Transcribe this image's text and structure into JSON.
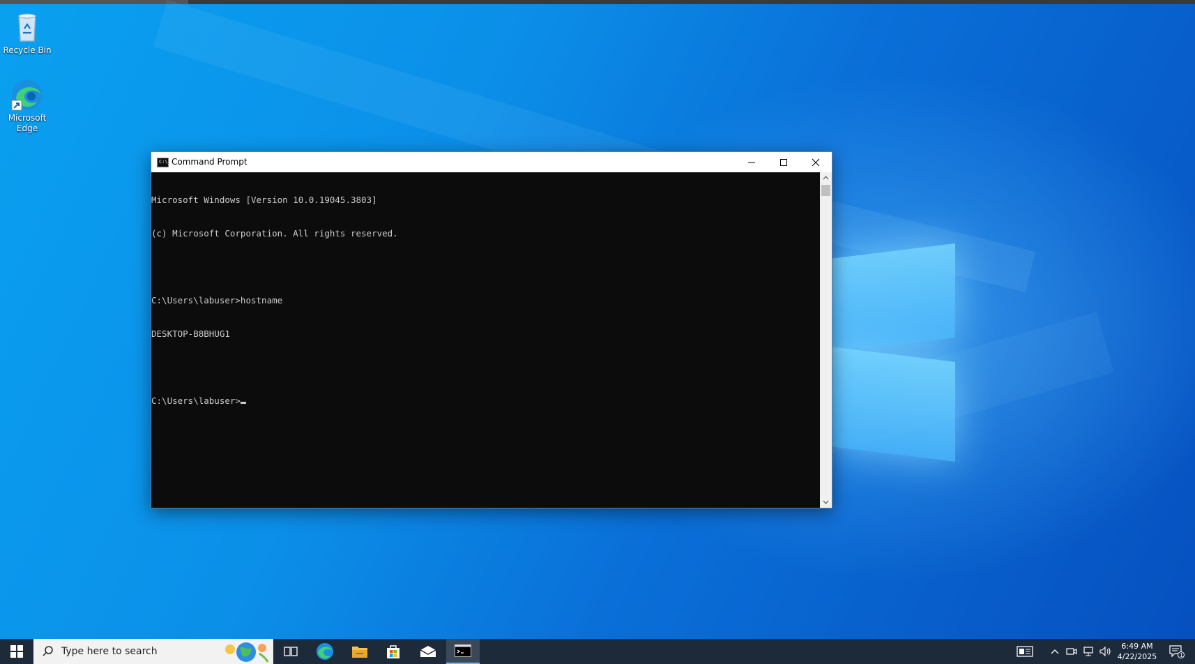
{
  "desktop": {
    "icons": [
      {
        "label": "Recycle Bin"
      },
      {
        "label": "Microsoft Edge"
      }
    ]
  },
  "cmd_window": {
    "title": "Command Prompt",
    "icon_text": "C:\\",
    "lines": [
      "Microsoft Windows [Version 10.0.19045.3803]",
      "(c) Microsoft Corporation. All rights reserved.",
      "",
      "C:\\Users\\labuser>hostname",
      "DESKTOP-B8BHUG1",
      "",
      "C:\\Users\\labuser>"
    ],
    "controls": {
      "minimize": "—",
      "maximize": "☐",
      "close": "✕"
    }
  },
  "taskbar": {
    "search_placeholder": "Type here to search",
    "pinned": [
      "task-view-icon",
      "edge-icon",
      "file-explorer-icon",
      "store-icon",
      "mail-icon",
      "cmd-icon"
    ],
    "clock": {
      "time": "6:49 AM",
      "date": "4/22/2025"
    },
    "notification_count": "1"
  },
  "colors": {
    "console_bg": "#0c0c0c",
    "console_fg": "#cccccc",
    "taskbar_bg": "#1d2a3a"
  }
}
